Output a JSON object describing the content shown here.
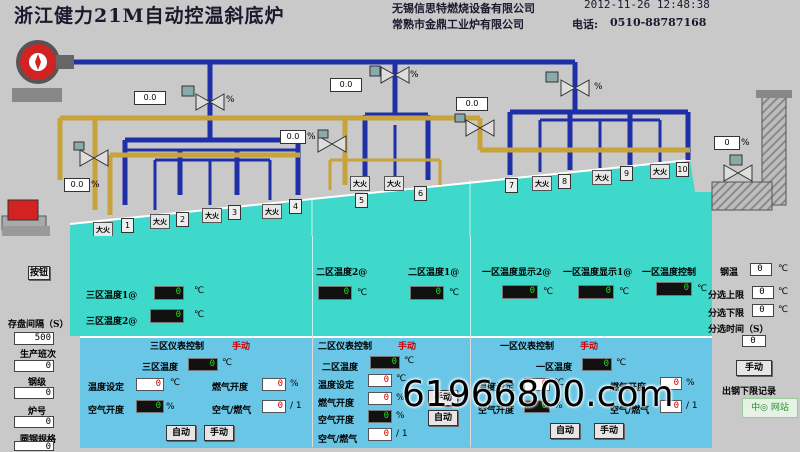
{
  "header": {
    "title": "浙江健力21M自动控温斜底炉",
    "company1": "无锡信思特燃烧设备有限公司",
    "company2": "常熟市金鼎工业炉有限公司",
    "datetime": "2012-11-26 12:48:38",
    "phone_label": "电话:",
    "phone": "0510-88787168"
  },
  "valves": [
    {
      "value": "0.0"
    },
    {
      "value": "0.0"
    },
    {
      "value": "0.0"
    },
    {
      "value": "0.0"
    },
    {
      "value": "0.0"
    },
    {
      "value": "0"
    }
  ],
  "pct_unit": "%",
  "burner_labels": [
    "1",
    "2",
    "3",
    "4",
    "5",
    "6",
    "7",
    "8",
    "9",
    "10"
  ],
  "big_fire": "大火",
  "left_panel": {
    "button": "按钮",
    "storage_interval_label": "存盘间隔（S）",
    "storage_interval": "500",
    "shift_label": "生产班次",
    "shift": "0",
    "grade_label": "钢级",
    "grade": "0",
    "heat_no_label": "炉号",
    "heat_no": "0",
    "spec_label": "圆钢规格",
    "spec": "0"
  },
  "zone3": {
    "temp1_label": "三区温度1@",
    "temp1": "0",
    "temp2_label": "三区温度2@",
    "temp2": "0",
    "unit": "℃"
  },
  "zone2": {
    "temp2_label": "二区温度2@",
    "temp2": "0",
    "temp1_label": "二区温度1@",
    "temp1": "0",
    "unit": "℃"
  },
  "zone1": {
    "disp2_label": "一区温度显示2@",
    "disp2": "0",
    "disp1_label": "一区温度显示1@",
    "disp1": "0",
    "ctrl_label": "一区温度控制",
    "ctrl": "0",
    "unit": "℃"
  },
  "right_panel": {
    "steel_label": "钢温",
    "steel": "0",
    "unit": "℃",
    "upper_label": "分选上限",
    "upper": "0",
    "lower_label": "分选下限",
    "lower": "0",
    "time_label": "分选时间（S）",
    "time": "0",
    "manual": "手动",
    "record_label": "出钢下限记录",
    "watermark": "中◎ 网站"
  },
  "ctrl3": {
    "header": "三区仪表控制",
    "mode": "手动",
    "temp_label": "三区温度",
    "temp": "0",
    "unit": "℃",
    "set_label": "温度设定",
    "set": "0",
    "air_label": "空气开度",
    "air": "0",
    "gas_label": "燃气开度",
    "gas": "0",
    "ratio_label": "空气/燃气",
    "ratio": "0",
    "ratio_sep": "/ 1",
    "pct": "%",
    "auto_btn": "自动",
    "manual_btn": "手动"
  },
  "ctrl2": {
    "header": "二区仪表控制",
    "mode": "手动",
    "temp_label": "二区温度",
    "temp": "0",
    "unit": "℃",
    "set_label": "温度设定",
    "set": "0",
    "gas_label": "燃气开度",
    "gas": "0",
    "air_label": "空气开度",
    "air": "0",
    "ratio_label": "空气/燃气",
    "ratio": "0",
    "ratio_sep": "/ 1",
    "pct": "%",
    "auto_btn": "自动",
    "manual_btn": "手动"
  },
  "ctrl1": {
    "header": "一区仪表控制",
    "mode": "手动",
    "temp_label": "一区温度",
    "temp": "0",
    "unit": "℃",
    "set_label": "温度设定",
    "set": "0",
    "air_label": "空气开度",
    "air": "0",
    "gas_label": "燃气开度",
    "gas": "0",
    "ratio_label": "空气/燃气",
    "ratio": "0",
    "ratio_sep": "/ 1",
    "pct": "%",
    "auto_btn": "自动",
    "manual_btn": "手动"
  },
  "overlay": {
    "text": "61966800.com"
  },
  "colors": {
    "zone": "#3ed9cb",
    "panel": "#6ac6e6",
    "gas_pipe": "#c8a23a",
    "air_pipe": "#1f2fa8"
  }
}
